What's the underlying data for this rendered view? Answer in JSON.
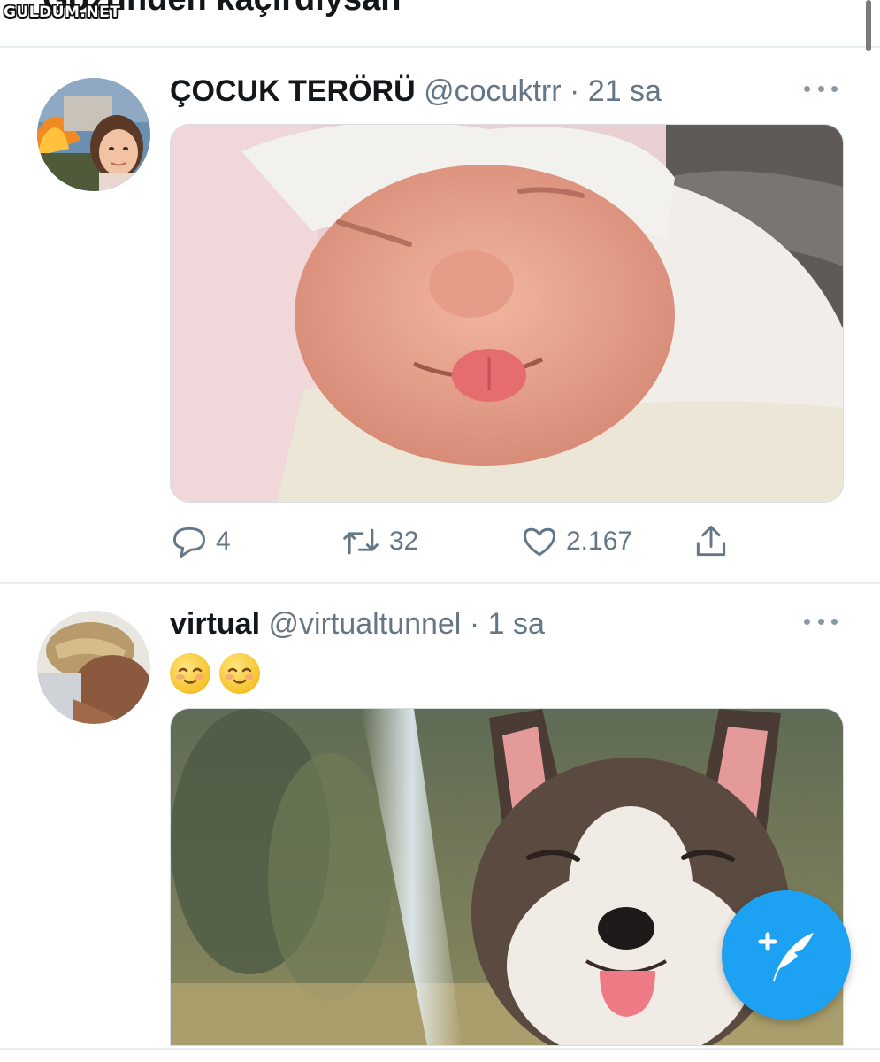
{
  "header": {
    "title": "Gözünden kaçırdıysan"
  },
  "watermark": "GULDUM.NET",
  "tweets": [
    {
      "name": "ÇOCUK TERÖRÜ",
      "handle": "@cocuktrr",
      "separator": "·",
      "time": "21 sa",
      "avatar": "girl-in-front-of-burning-house",
      "media": "newborn-baby-smiling-with-tongue-out",
      "actions": {
        "replies": "4",
        "retweets": "32",
        "likes": "2.167"
      }
    },
    {
      "name": "virtual",
      "handle": "@virtualtunnel",
      "separator": "·",
      "time": "1 sa",
      "avatar": "woman-with-braided-hair",
      "emoji_text": "😌😌",
      "media": "smiling-puppy-in-forest"
    }
  ],
  "fab": {
    "icon": "compose-tweet-icon"
  },
  "colors": {
    "accent": "#1da1f2",
    "muted": "#657786",
    "text": "#14171a",
    "divider": "#e6ecf0"
  }
}
